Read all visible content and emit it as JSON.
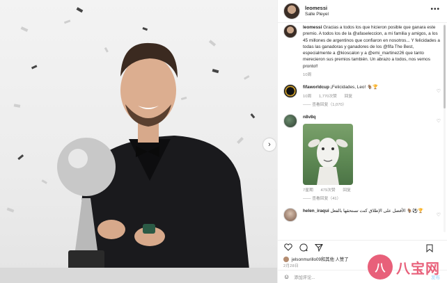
{
  "post": {
    "username": "leomessi",
    "location": "Salle Pleyel",
    "caption_user": "leomessi",
    "caption_text": "Gracias a todos los que hicieron posible que ganara este premio. A todos los de la @afaseleccion, a mi familia y amigos, a los 45 millones de argentinos que confiaron en nosotros... Y felicidades a todas las ganadoras y ganadores de los @fifa The Best, especialmente a @kioscalon y a @emi_martinez26 que tanto merecieron sus premios también. Un abrazo a todos, nos vemos pronto!!",
    "caption_time": "10周"
  },
  "comments": [
    {
      "user": "fifaworldcup",
      "text": "¡Felicidades, Leo! 🐐🏆",
      "meta": [
        "10周",
        "1,770次赞",
        "回复"
      ],
      "more": "—— 查看回复（1,070）"
    },
    {
      "user": "n8v8q",
      "text": "",
      "meta": [
        "7星期",
        "479次赞",
        "回复"
      ],
      "more": "—— 查看回复（41）"
    },
    {
      "user": "helen_iraqui",
      "text": "الأفضل على الإطلاق كنت تستحقها بالفعل 🐐⚽🏆",
      "meta": [],
      "more": ""
    }
  ],
  "actions": {
    "icons": [
      "heart-icon",
      "comment-icon",
      "share-icon",
      "bookmark-icon"
    ]
  },
  "likes_text": "jelsonmurillo09和其他 人赞了",
  "timestamp": "2月28日",
  "add_comment": {
    "emoji": "☺",
    "placeholder": "添加评论...",
    "post_label": "发布"
  },
  "watermark": {
    "logo_char": "八",
    "text": "八宝网"
  }
}
